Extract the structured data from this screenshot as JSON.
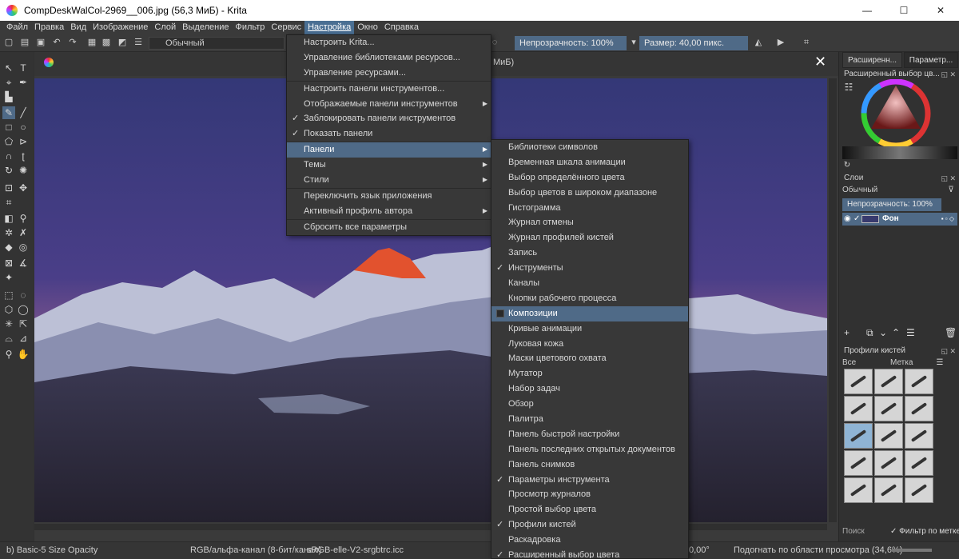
{
  "window": {
    "title": "CompDeskWalCol-2969__006.jpg (56,3 МиБ)  - Krita",
    "min_glyph": "—",
    "max_glyph": "☐",
    "close_glyph": "✕"
  },
  "menubar": [
    "Файл",
    "Правка",
    "Вид",
    "Изображение",
    "Слой",
    "Выделение",
    "Фильтр",
    "Сервис",
    "Настройка",
    "Окно",
    "Справка"
  ],
  "toolbar": {
    "blend_mode": "Обычный",
    "opacity": "Непрозрачность: 100%",
    "size": "Размер: 40,00 пикс."
  },
  "document_tab": {
    "title_fragment": "МиБ)",
    "close_glyph": "✕"
  },
  "settings_menu": {
    "items": [
      {
        "label": "Настроить Krita...",
        "check": "",
        "arrow": ""
      },
      {
        "label": "Управление библиотеками ресурсов...",
        "check": "",
        "arrow": ""
      },
      {
        "label": "Управление ресурсами...",
        "check": "",
        "arrow": ""
      },
      {
        "label": "Настроить панели инструментов...",
        "check": "",
        "arrow": ""
      },
      {
        "label": "Отображаемые панели инструментов",
        "check": "",
        "arrow": "▶"
      },
      {
        "label": "Заблокировать панели инструментов",
        "check": "✓",
        "arrow": ""
      },
      {
        "label": "Показать панели",
        "check": "✓",
        "arrow": ""
      },
      {
        "label": "Панели",
        "check": "",
        "arrow": "▶"
      },
      {
        "label": "Темы",
        "check": "",
        "arrow": "▶"
      },
      {
        "label": "Стили",
        "check": "",
        "arrow": "▶"
      },
      {
        "label": "Переключить язык приложения",
        "check": "",
        "arrow": ""
      },
      {
        "label": "Активный профиль автора",
        "check": "",
        "arrow": "▶"
      },
      {
        "label": "Сбросить все параметры",
        "check": "",
        "arrow": ""
      }
    ]
  },
  "dockers_menu": {
    "items": [
      {
        "label": "Библиотеки символов",
        "check": ""
      },
      {
        "label": "Временная шкала анимации",
        "check": ""
      },
      {
        "label": "Выбор определённого цвета",
        "check": ""
      },
      {
        "label": "Выбор цветов в широком диапазоне",
        "check": ""
      },
      {
        "label": "Гистограмма",
        "check": ""
      },
      {
        "label": "Журнал отмены",
        "check": ""
      },
      {
        "label": "Журнал профилей кистей",
        "check": ""
      },
      {
        "label": "Запись",
        "check": ""
      },
      {
        "label": "Инструменты",
        "check": "✓"
      },
      {
        "label": "Каналы",
        "check": ""
      },
      {
        "label": "Кнопки рабочего процесса",
        "check": ""
      },
      {
        "label": "Композиции",
        "check": ""
      },
      {
        "label": "Кривые анимации",
        "check": ""
      },
      {
        "label": "Луковая кожа",
        "check": ""
      },
      {
        "label": "Маски цветового охвата",
        "check": ""
      },
      {
        "label": "Мутатор",
        "check": ""
      },
      {
        "label": "Набор задач",
        "check": ""
      },
      {
        "label": "Обзор",
        "check": ""
      },
      {
        "label": "Палитра",
        "check": ""
      },
      {
        "label": "Панель быстрой настройки",
        "check": ""
      },
      {
        "label": "Панель последних открытых документов",
        "check": ""
      },
      {
        "label": "Панель снимков",
        "check": ""
      },
      {
        "label": "Параметры инструмента",
        "check": "✓"
      },
      {
        "label": "Просмотр журналов",
        "check": ""
      },
      {
        "label": "Простой выбор цвета",
        "check": ""
      },
      {
        "label": "Профили кистей",
        "check": "✓"
      },
      {
        "label": "Раскадровка",
        "check": ""
      },
      {
        "label": "Расширенный выбор цвета",
        "check": "✓"
      }
    ]
  },
  "dock": {
    "tabs": [
      "Расширенн...",
      "Параметр..."
    ],
    "color_panel_title": "Расширенный выбор цв...",
    "layers_title": "Слои",
    "layers_blend": "Обычный",
    "layers_opacity": "Непрозрачность: 100%",
    "layer_name": "Фон",
    "brushes_title": "Профили кистей",
    "brushes_filter": "Все",
    "brushes_tag": "Метка",
    "search_placeholder": "Поиск",
    "filter_by_tag": "Фильтр по метке"
  },
  "statusbar": {
    "brush": "b) Basic-5 Size Opacity",
    "color_model": "RGB/альфа-канал (8-бит/канал)",
    "profile": "sRGB-elle-V2-srgbtrc.icc",
    "rotation": "0,00°",
    "zoom": "Подогнать по области просмотра (34,6%)"
  }
}
